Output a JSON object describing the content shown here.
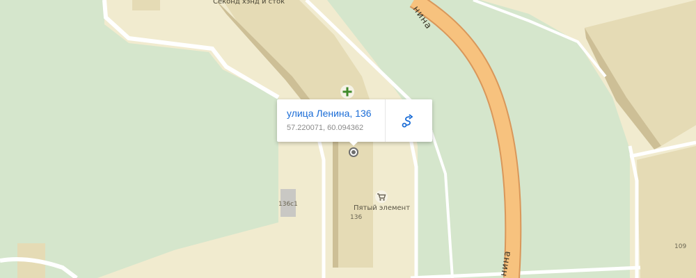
{
  "map": {
    "colors": {
      "land": "#f1ebcf",
      "park": "#d5e6cc",
      "building": "#e5dbb5",
      "building_shadow": "#cdbf96",
      "road_main_fill": "#f7c27e",
      "road_main_casing": "#d9975a",
      "road_minor": "#ffffff"
    },
    "labels": {
      "poi_top": "Секонд хэнд и сток",
      "street": "Ленина",
      "street_upper": "нина",
      "street_lower": "нина",
      "house_136c1": "136с1",
      "shop_name": "Пятый элемент",
      "house_136": "136",
      "house_109": "109"
    },
    "icons": {
      "pharmacy": "plus-icon",
      "shop": "cart-icon",
      "selected": "location-dot-icon"
    }
  },
  "popup": {
    "title": "улица Ленина, 136",
    "coords": "57.220071, 60.094362",
    "route_icon": "route-icon"
  }
}
